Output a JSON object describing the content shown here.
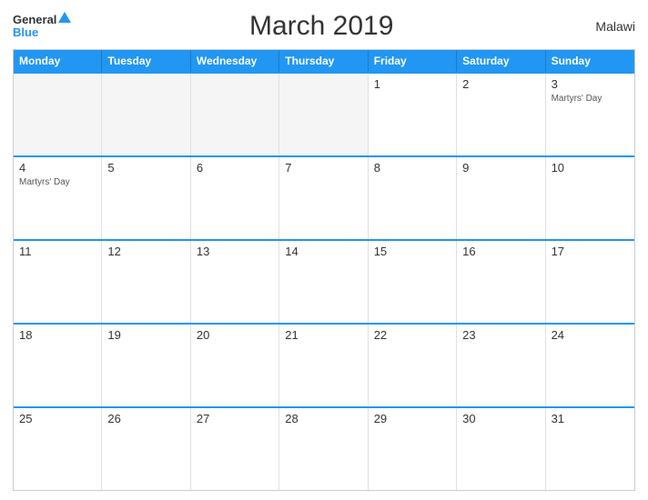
{
  "header": {
    "logo_general": "General",
    "logo_blue": "Blue",
    "title": "March 2019",
    "country": "Malawi"
  },
  "days_of_week": [
    "Monday",
    "Tuesday",
    "Wednesday",
    "Thursday",
    "Friday",
    "Saturday",
    "Sunday"
  ],
  "weeks": [
    [
      {
        "day": "",
        "event": "",
        "shaded": true
      },
      {
        "day": "",
        "event": "",
        "shaded": true
      },
      {
        "day": "",
        "event": "",
        "shaded": true
      },
      {
        "day": "",
        "event": "",
        "shaded": true
      },
      {
        "day": "1",
        "event": ""
      },
      {
        "day": "2",
        "event": ""
      },
      {
        "day": "3",
        "event": "Martyrs' Day"
      }
    ],
    [
      {
        "day": "4",
        "event": "Martyrs' Day"
      },
      {
        "day": "5",
        "event": ""
      },
      {
        "day": "6",
        "event": ""
      },
      {
        "day": "7",
        "event": ""
      },
      {
        "day": "8",
        "event": ""
      },
      {
        "day": "9",
        "event": ""
      },
      {
        "day": "10",
        "event": ""
      }
    ],
    [
      {
        "day": "11",
        "event": ""
      },
      {
        "day": "12",
        "event": ""
      },
      {
        "day": "13",
        "event": ""
      },
      {
        "day": "14",
        "event": ""
      },
      {
        "day": "15",
        "event": ""
      },
      {
        "day": "16",
        "event": ""
      },
      {
        "day": "17",
        "event": ""
      }
    ],
    [
      {
        "day": "18",
        "event": ""
      },
      {
        "day": "19",
        "event": ""
      },
      {
        "day": "20",
        "event": ""
      },
      {
        "day": "21",
        "event": ""
      },
      {
        "day": "22",
        "event": ""
      },
      {
        "day": "23",
        "event": ""
      },
      {
        "day": "24",
        "event": ""
      }
    ],
    [
      {
        "day": "25",
        "event": ""
      },
      {
        "day": "26",
        "event": ""
      },
      {
        "day": "27",
        "event": ""
      },
      {
        "day": "28",
        "event": ""
      },
      {
        "day": "29",
        "event": ""
      },
      {
        "day": "30",
        "event": ""
      },
      {
        "day": "31",
        "event": ""
      }
    ]
  ],
  "colors": {
    "header_bg": "#2196F3",
    "border_top": "#2196F3"
  }
}
